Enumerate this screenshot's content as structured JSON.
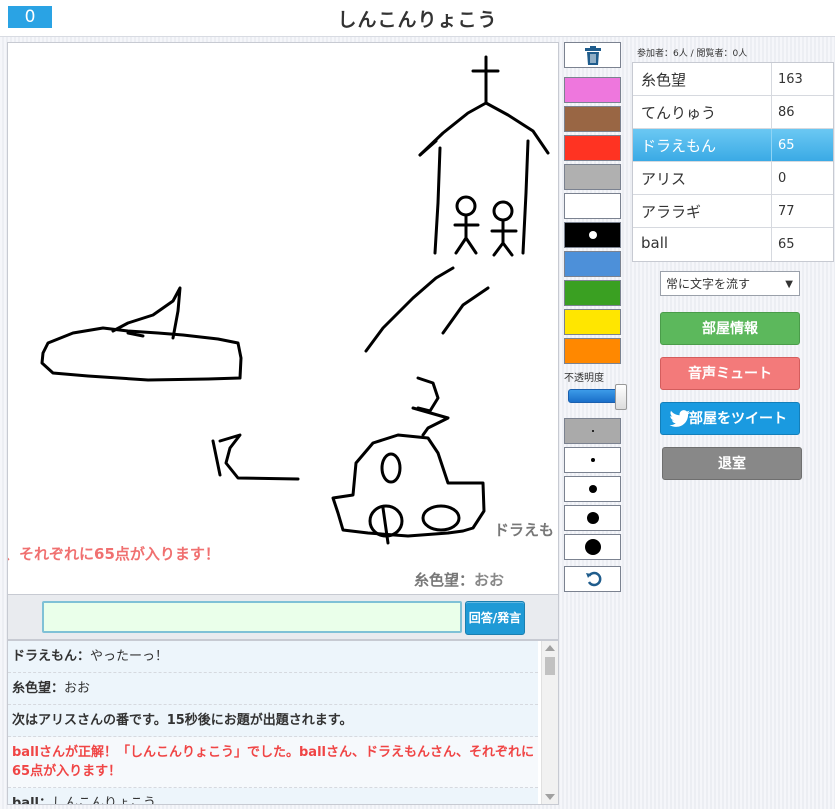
{
  "header": {
    "badge": "0",
    "title": "しんこんりょこう"
  },
  "canvas": {
    "flow_red": "、それぞれに65点が入ります！",
    "flow_gray": "ドラえも",
    "flow_msg_name": "糸色望：",
    "flow_msg_text": "おお"
  },
  "answer": {
    "value": "",
    "button": "回答/発言"
  },
  "chat": [
    {
      "name": "ドラえもん：",
      "text": "やったーっ！",
      "type": "normal"
    },
    {
      "name": "糸色望：",
      "text": "おお",
      "type": "normal"
    },
    {
      "name": "",
      "text": "次はアリスさんの番です。15秒後にお題が出題されます。",
      "type": "system"
    },
    {
      "name": "",
      "text": "ballさんが正解！「しんこんりょこう」でした。ballさん、ドラえもんさん、それぞれに65点が入ります！",
      "type": "red"
    },
    {
      "name": "ball：",
      "text": "しんこんりょこう",
      "type": "normal"
    }
  ],
  "tools": {
    "colors": [
      "#ee77dd",
      "#996644",
      "#ff3322",
      "#b0b0b0",
      "#ffffff",
      "#000000",
      "#4d90d9",
      "#3aa022",
      "#ffe600",
      "#ff8800"
    ],
    "opacity_label": "不透明度",
    "opacity_value": 100,
    "brush_sizes": [
      2,
      4,
      8,
      12,
      16
    ]
  },
  "counts": {
    "participants_label": "参加者：",
    "participants": "6人",
    "sep": " / ",
    "viewers_label": "閲覧者：",
    "viewers": "0人"
  },
  "players": [
    {
      "name": "糸色望",
      "score": "163",
      "active": false
    },
    {
      "name": "てんりゅう",
      "score": "86",
      "active": false
    },
    {
      "name": "ドラえもん",
      "score": "65",
      "active": true
    },
    {
      "name": "アリス",
      "score": "0",
      "active": false
    },
    {
      "name": "アララギ",
      "score": "77",
      "active": false
    },
    {
      "name": "ball",
      "score": "65",
      "active": false
    }
  ],
  "controls": {
    "flow_select": "常に文字を流す",
    "room_info": "部屋情報",
    "mute": "音声ミュート",
    "tweet": "部屋をツイート",
    "leave": "退室"
  }
}
